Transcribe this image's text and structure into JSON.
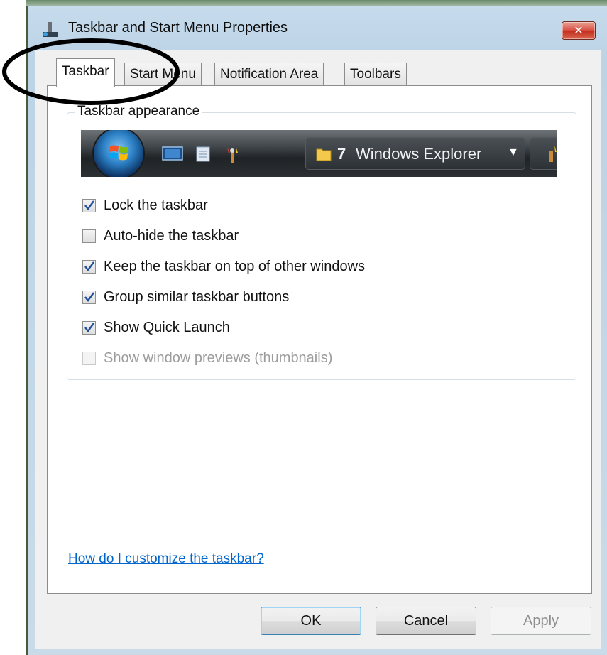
{
  "window": {
    "title": "Taskbar and Start Menu Properties",
    "close_label": "✕"
  },
  "tabs": [
    {
      "label": "Taskbar",
      "active": true
    },
    {
      "label": "Start Menu",
      "active": false
    },
    {
      "label": "Notification Area",
      "active": false
    },
    {
      "label": "Toolbars",
      "active": false
    }
  ],
  "group": {
    "label": "Taskbar appearance"
  },
  "preview": {
    "button_count": "7",
    "button_label": "Windows Explorer"
  },
  "options": [
    {
      "label": "Lock the taskbar",
      "checked": true,
      "enabled": true
    },
    {
      "label": "Auto-hide the taskbar",
      "checked": false,
      "enabled": true
    },
    {
      "label": "Keep the taskbar on top of other windows",
      "checked": true,
      "enabled": true
    },
    {
      "label": "Group similar taskbar buttons",
      "checked": true,
      "enabled": true
    },
    {
      "label": "Show Quick Launch",
      "checked": true,
      "enabled": true
    },
    {
      "label": "Show window previews (thumbnails)",
      "checked": false,
      "enabled": false
    }
  ],
  "help_link": "How do I customize the taskbar?",
  "buttons": {
    "ok": "OK",
    "cancel": "Cancel",
    "apply": "Apply"
  },
  "colors": {
    "accent_link": "#0066cc",
    "close_button": "#c5301f",
    "annotation": "#000000"
  }
}
